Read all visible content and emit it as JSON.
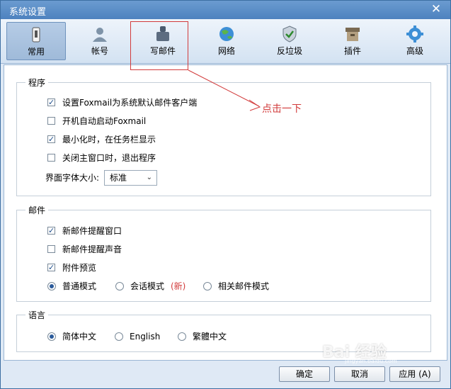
{
  "window": {
    "title": "系统设置",
    "close_glyph": "✕"
  },
  "toolbar": {
    "tabs": [
      {
        "label": "常用",
        "icon": "general-icon",
        "active": true
      },
      {
        "label": "帐号",
        "icon": "account-icon",
        "active": false
      },
      {
        "label": "写邮件",
        "icon": "compose-icon",
        "active": false
      },
      {
        "label": "网络",
        "icon": "network-icon",
        "active": false
      },
      {
        "label": "反垃圾",
        "icon": "anti-spam-icon",
        "active": false
      },
      {
        "label": "插件",
        "icon": "plugin-icon",
        "active": false
      },
      {
        "label": "高级",
        "icon": "advanced-icon",
        "active": false
      }
    ]
  },
  "annotation": {
    "text": "点击一下",
    "color": "#d23b3b"
  },
  "groups": {
    "program": {
      "title": "程序",
      "options": [
        {
          "label": "设置Foxmail为系统默认邮件客户端",
          "checked": true
        },
        {
          "label": "开机自动启动Foxmail",
          "checked": false
        },
        {
          "label": "最小化时，在任务栏显示",
          "checked": true
        },
        {
          "label": "关闭主窗口时，退出程序",
          "checked": false
        }
      ],
      "font_size_label": "界面字体大小:",
      "font_size_value": "标准"
    },
    "mail": {
      "title": "邮件",
      "options": [
        {
          "label": "新邮件提醒窗口",
          "checked": true
        },
        {
          "label": "新邮件提醒声音",
          "checked": false
        },
        {
          "label": "附件预览",
          "checked": true
        }
      ],
      "modes": [
        {
          "label": "普通模式",
          "selected": true
        },
        {
          "label": "会话模式",
          "selected": false,
          "badge": "(新)"
        },
        {
          "label": "相关邮件模式",
          "selected": false
        }
      ]
    },
    "language": {
      "title": "语言",
      "options": [
        {
          "label": "简体中文",
          "selected": true
        },
        {
          "label": "English",
          "selected": false
        },
        {
          "label": "繁體中文",
          "selected": false
        }
      ]
    }
  },
  "footer": {
    "ok": "确定",
    "cancel": "取消",
    "apply": "应用 (A)"
  },
  "watermark": {
    "text": "Bai 经验",
    "subtext": "jingyan.baidu.com"
  }
}
